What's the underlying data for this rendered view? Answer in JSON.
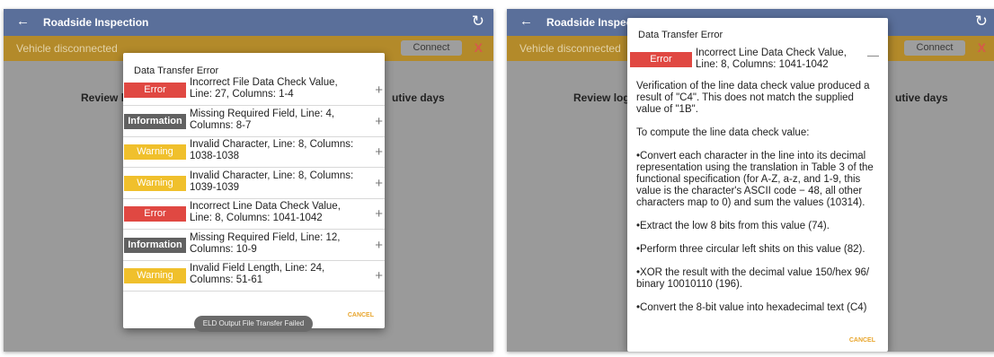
{
  "app": {
    "title": "Roadside Inspection",
    "back_icon": "arrow-left-icon",
    "refresh_icon": "refresh-icon",
    "appbar_color": "#5a6f9a",
    "alert_color": "#b38a2a"
  },
  "alert": {
    "message": "Vehicle disconnected",
    "connect_label": "Connect",
    "close_label": "X"
  },
  "background": {
    "left_text": "Review logs",
    "right_text": "utive days"
  },
  "left_dialog": {
    "title": "Data Transfer Error",
    "rows": [
      {
        "type": "Error",
        "text": "Incorrect File Data Check Value, Line: 27, Columns: 1-4"
      },
      {
        "type": "Information",
        "text": "Missing Required Field, Line: 4, Columns: 8-7"
      },
      {
        "type": "Warning",
        "text": "Invalid Character, Line: 8, Columns: 1038-1038"
      },
      {
        "type": "Warning",
        "text": "Invalid Character, Line: 8, Columns: 1039-1039"
      },
      {
        "type": "Error",
        "text": "Incorrect Line Data Check Value, Line: 8, Columns: 1041-1042"
      },
      {
        "type": "Information",
        "text": "Missing Required Field, Line: 12, Columns: 10-9"
      },
      {
        "type": "Warning",
        "text": "Invalid Field Length, Line: 24, Columns: 51-61"
      }
    ],
    "expand_icon": "+",
    "cancel_label": "CANCEL"
  },
  "toast": {
    "text": "ELD Output File Transfer Failed"
  },
  "right_dialog": {
    "title": "Data Transfer Error",
    "row": {
      "type": "Error",
      "text": "Incorrect Line Data Check Value, Line: 8, Columns: 1041-1042"
    },
    "collapse_icon": "—",
    "paragraphs": [
      "Verification of the line data check value produced a result of \"C4\". This does not match the supplied value of \"1B\".",
      "To compute the line data check value:",
      "•Convert each character in the line into its decimal representation using the translation in Table 3 of the functional specification (for A-Z, a-z, and 1-9, this value is the character's ASCII code − 48, all other characters map to 0) and sum the values (10314).",
      "•Extract the low 8 bits from this value (74).",
      "•Perform three circular left shits on this value (82).",
      "•XOR the result with the decimal value 150/hex 96/ binary 10010110 (196).",
      "•Convert the 8-bit value into hexadecimal text (C4)"
    ],
    "cancel_label": "CANCEL"
  },
  "colors": {
    "error": "#e04842",
    "information": "#616161",
    "warning": "#f0c02c",
    "cancel": "#e8a52c"
  }
}
